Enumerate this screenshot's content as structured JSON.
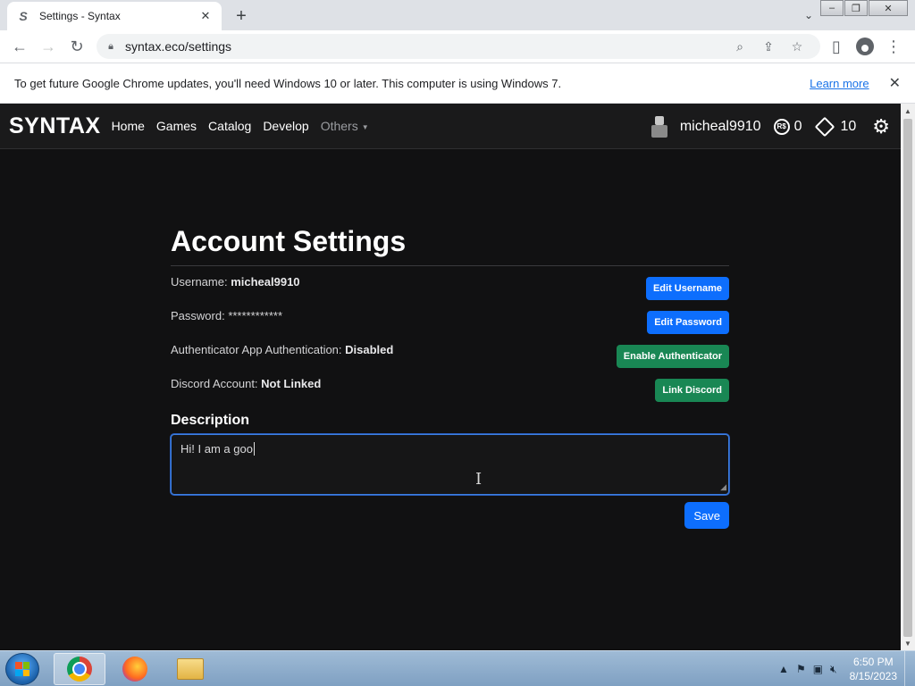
{
  "browser": {
    "tab_title": "Settings - Syntax",
    "tab_favicon": "S",
    "url": "syntax.eco/settings",
    "infobar_message": "To get future Google Chrome updates, you'll need Windows 10 or later. This computer is using Windows 7.",
    "infobar_link": "Learn more"
  },
  "site_nav": {
    "brand": "SYNTAX",
    "links": [
      "Home",
      "Games",
      "Catalog",
      "Develop"
    ],
    "others_label": "Others",
    "username": "micheal9910",
    "robux": "0",
    "tix": "10",
    "robux_icon_text": "R$"
  },
  "settings": {
    "title": "Account Settings",
    "username_label": "Username: ",
    "username_value": "micheal9910",
    "edit_username": "Edit Username",
    "password_label": "Password: ",
    "password_value": "************",
    "edit_password": "Edit Password",
    "auth_label": "Authenticator App Authentication: ",
    "auth_value": "Disabled",
    "enable_auth": "Enable Authenticator",
    "discord_label": "Discord Account: ",
    "discord_value": "Not Linked",
    "link_discord": "Link Discord",
    "description_heading": "Description",
    "description_value": "Hi! I am a goo",
    "save_label": "Save"
  },
  "taskbar": {
    "time": "6:50 PM",
    "date": "8/15/2023"
  },
  "colors": {
    "page_bg": "#111112",
    "primary_blue": "#0d6efd",
    "success_green": "#198754"
  }
}
